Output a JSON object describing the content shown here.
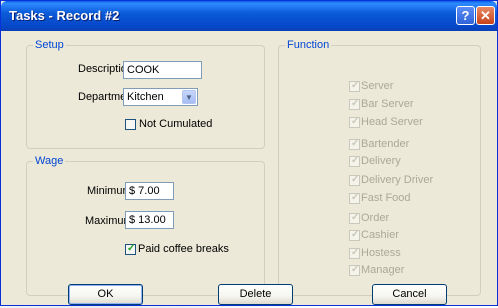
{
  "window": {
    "title": "Tasks - Record #2",
    "help_label": "?",
    "close_label": "✕"
  },
  "setup": {
    "title": "Setup",
    "description_label": "Description",
    "description_value": "COOK",
    "department_label": "Department",
    "department_value": "Kitchen",
    "not_cumulated_label": "Not Cumulated",
    "not_cumulated_checked": false
  },
  "wage": {
    "title": "Wage",
    "minimum_label": "Minimum",
    "minimum_value": "$ 7.00",
    "maximum_label": "Maximum",
    "maximum_value": "$ 13.00",
    "paid_breaks_label": "Paid coffee breaks",
    "paid_breaks_checked": true
  },
  "function": {
    "title": "Function",
    "items": [
      {
        "label": "Server",
        "checked": true
      },
      {
        "label": "Bar Server",
        "checked": true
      },
      {
        "label": "Head Server",
        "checked": true
      },
      {
        "label": "Bartender",
        "checked": true
      },
      {
        "label": "Delivery",
        "checked": true
      },
      {
        "label": "Delivery Driver",
        "checked": true
      },
      {
        "label": "Fast Food",
        "checked": true
      },
      {
        "label": "Order",
        "checked": true
      },
      {
        "label": "Cashier",
        "checked": true
      },
      {
        "label": "Hostess",
        "checked": true
      },
      {
        "label": "Manager",
        "checked": true
      }
    ]
  },
  "buttons": {
    "ok": "OK",
    "delete": "Delete",
    "cancel": "Cancel"
  },
  "icons": {
    "check": "check-icon",
    "dropdown": "chevron-down-icon"
  }
}
